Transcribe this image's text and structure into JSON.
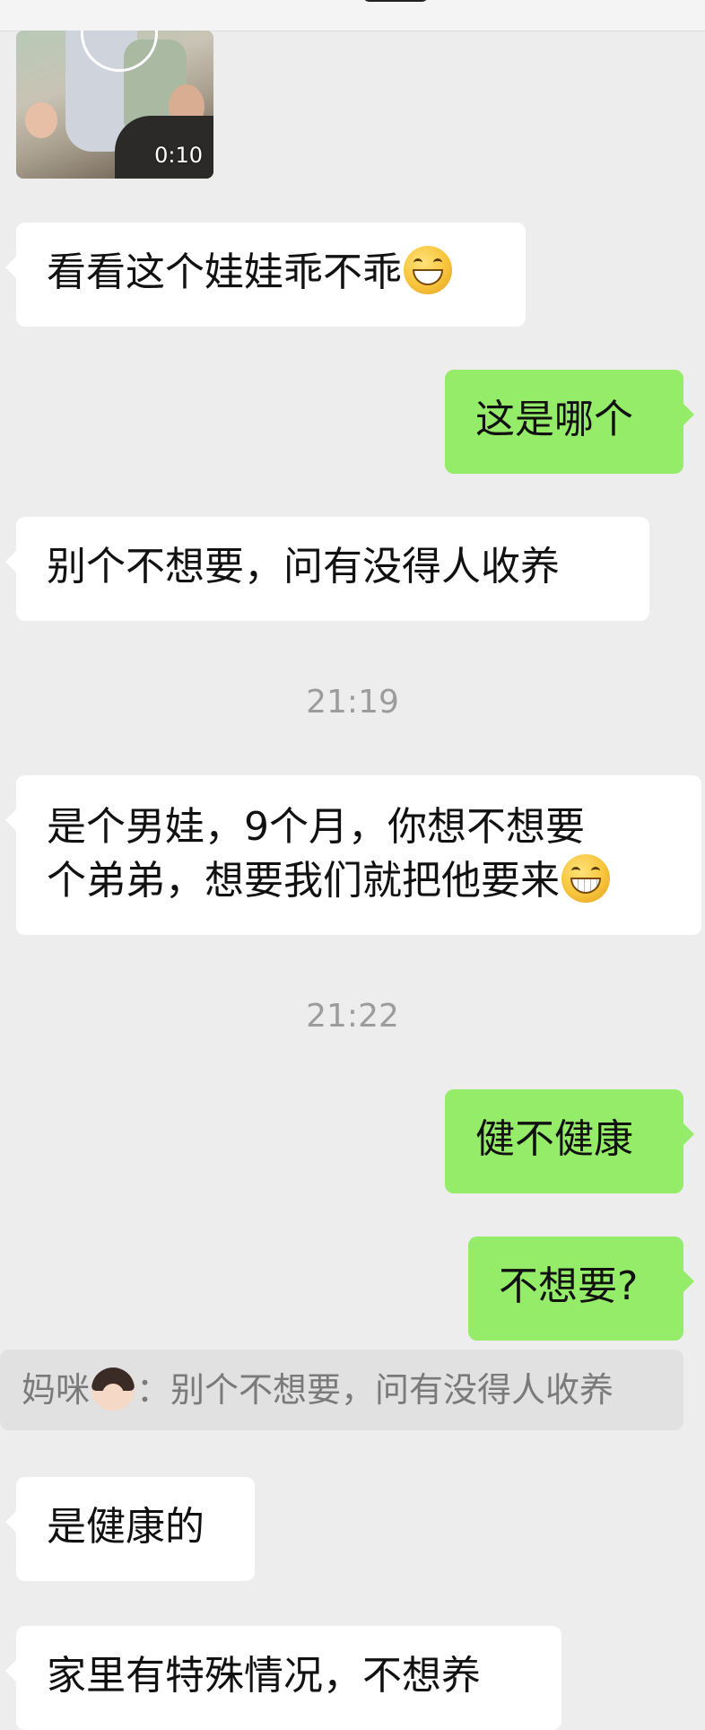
{
  "video": {
    "duration": "0:10"
  },
  "messages": [
    {
      "side": "left",
      "text": "看看这个娃娃乖不乖",
      "emoji": "grinning-face-icon"
    },
    {
      "side": "right",
      "text": "这是哪个"
    },
    {
      "side": "left",
      "text": "别个不想要，问有没得人收养"
    },
    {
      "side": "left",
      "line1": "是个男娃，9个月，你想不想要",
      "line2": "个弟弟，想要我们就把他要来",
      "emoji": "grinning-teeth-face-icon"
    },
    {
      "side": "right",
      "text": "健不健康"
    },
    {
      "side": "right",
      "text": "不想要?"
    },
    {
      "side": "left",
      "text": "是健康的"
    },
    {
      "side": "left",
      "text": "家里有特殊情况，不想养"
    }
  ],
  "timestamps": [
    "21:19",
    "21:22"
  ],
  "quote": {
    "name": "妈咪",
    "icon": "woman-emoji-icon",
    "separator": "：",
    "text": "别个不想要，问有没得人收养"
  },
  "colors": {
    "background": "#ededed",
    "incoming": "#ffffff",
    "outgoing": "#95ec69"
  }
}
